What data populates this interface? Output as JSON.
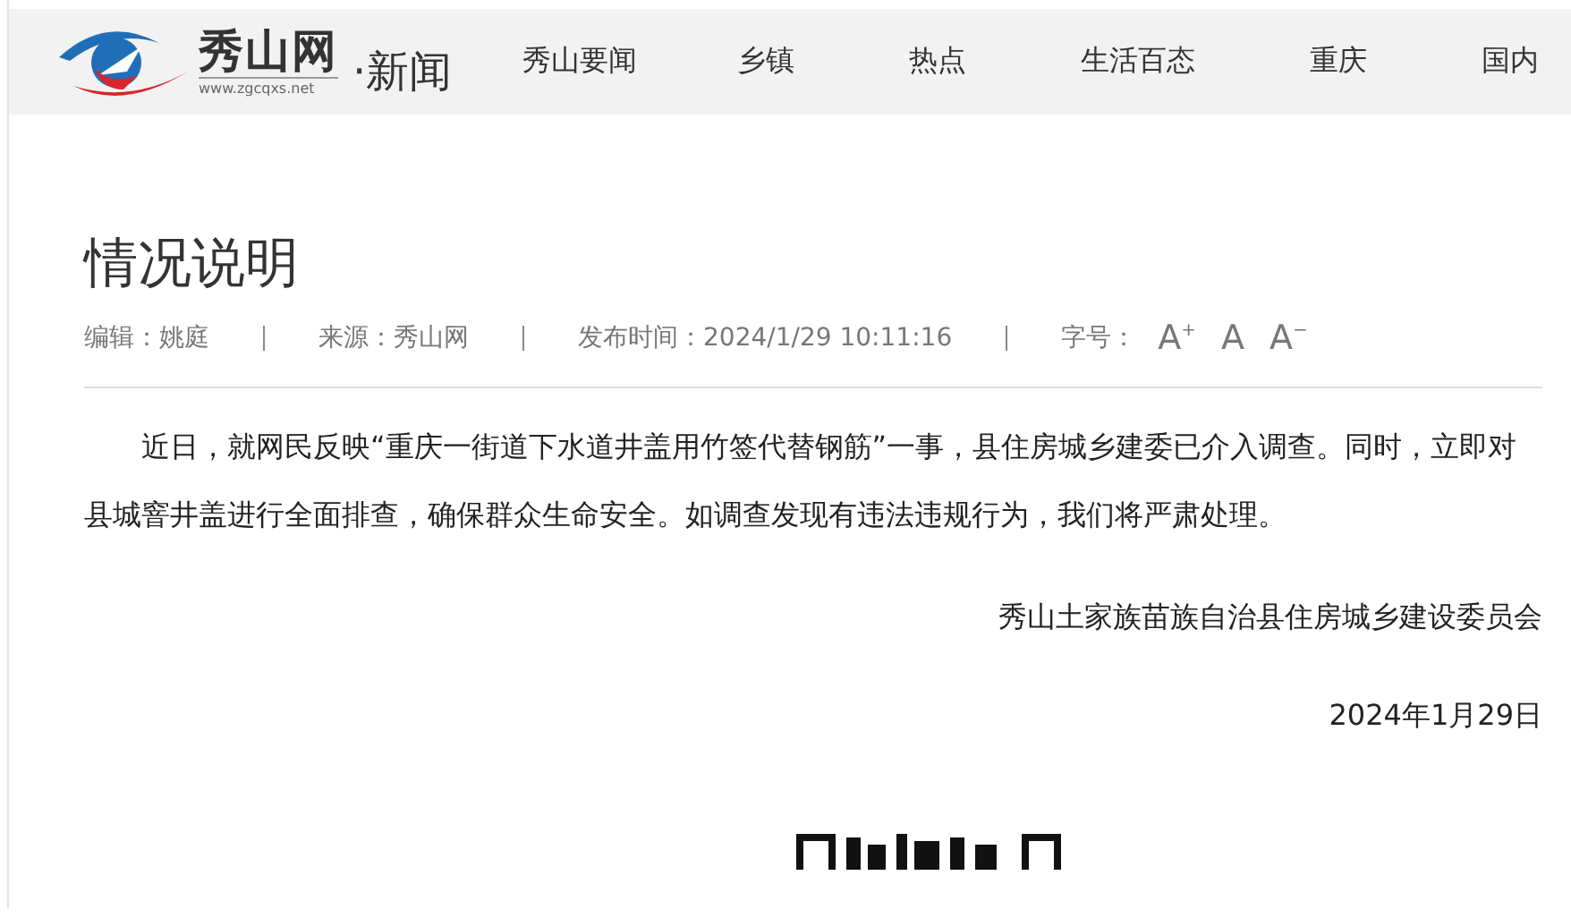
{
  "header": {
    "logo": {
      "name": "秀山网",
      "url": "www.zgcqxs.net"
    },
    "section": "·新闻",
    "nav": [
      {
        "label": "秀山要闻"
      },
      {
        "label": "乡镇"
      },
      {
        "label": "热点"
      },
      {
        "label": "生活百态"
      },
      {
        "label": "重庆"
      },
      {
        "label": "国内"
      }
    ]
  },
  "article": {
    "title": "情况说明",
    "meta": [
      {
        "kind": "text",
        "text": "编辑：姚庭"
      },
      {
        "kind": "text",
        "text": "来源：秀山网"
      },
      {
        "kind": "text",
        "text": "发布时间：2024/1/29 10:11:16"
      },
      {
        "kind": "fontsize",
        "label": "字号：",
        "sizes": [
          "A$^{+}$",
          "A",
          "A$^{−}$"
        ]
      }
    ],
    "paragraphs": [
      "近日，就网民反映“重庆一街道下水道井盖用竹签代替钢筋”一事，县住房城乡建委已介入调查。同时，立即对县城窨井盖进行全面排查，确保群众生命安全。如调查发现有违法违规行为，我们将严肃处理。"
    ],
    "signature": "秀山土家族苗族自治县住房城乡建设委员会",
    "date": "2024年1月29日"
  }
}
